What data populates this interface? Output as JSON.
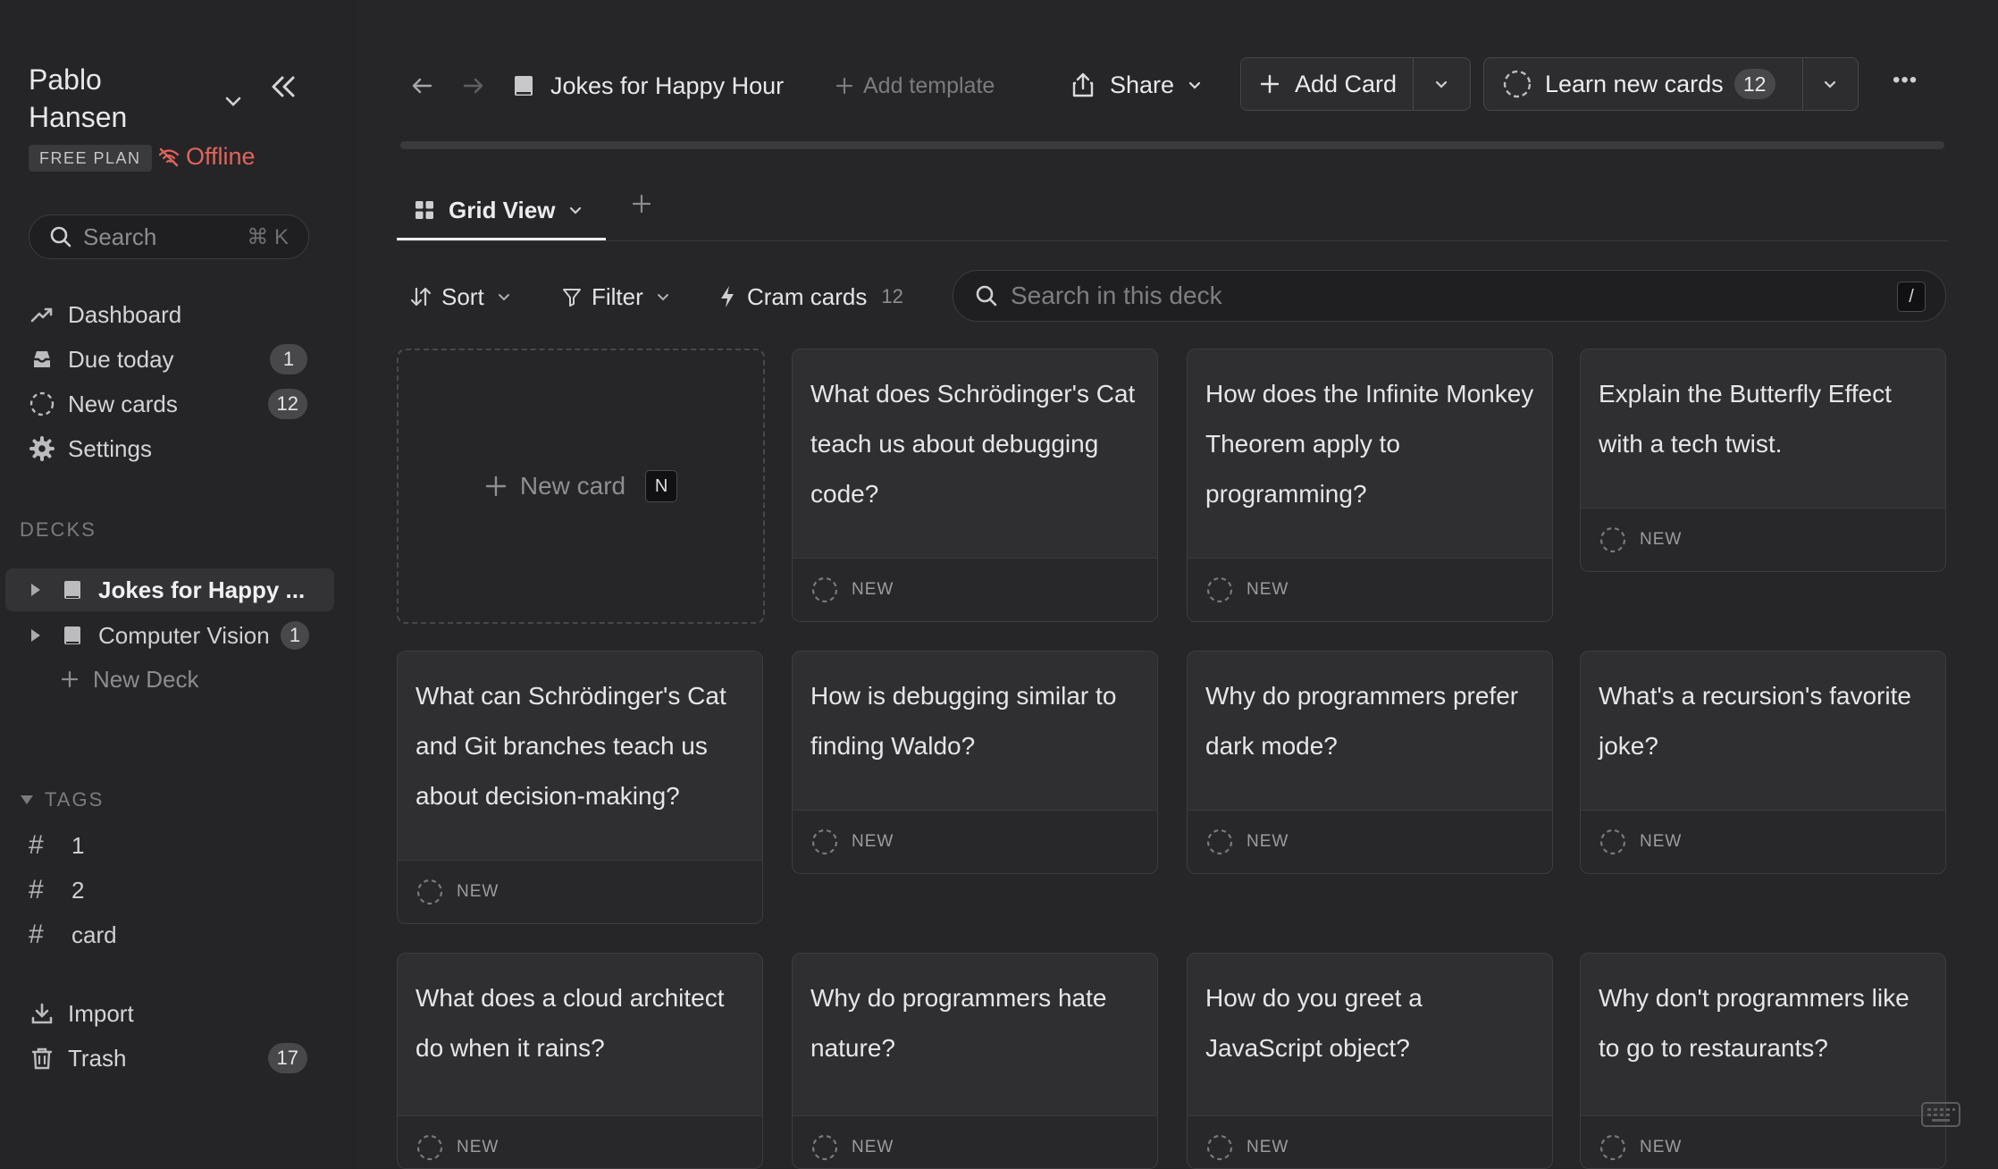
{
  "window": {
    "traffic_colors": [
      "#ee5f57",
      "#f5bd2e",
      "#29c840"
    ]
  },
  "sidebar": {
    "user_name": "Pablo Hansen",
    "plan": "FREE PLAN",
    "status": "Offline",
    "search": {
      "placeholder": "Search",
      "shortcut": "⌘ K"
    },
    "nav": [
      {
        "label": "Dashboard",
        "icon": "trend-icon"
      },
      {
        "label": "Due today",
        "icon": "inbox-icon",
        "count": "1"
      },
      {
        "label": "New cards",
        "icon": "dashed-circle-icon",
        "count": "12"
      },
      {
        "label": "Settings",
        "icon": "gear-icon"
      }
    ],
    "decks_label": "DECKS",
    "decks": [
      {
        "label": "Jokes for Happy ...",
        "active": true
      },
      {
        "label": "Computer Vision",
        "count": "1"
      }
    ],
    "new_deck": "New Deck",
    "tags_label": "TAGS",
    "tags": [
      "1",
      "2",
      "card"
    ],
    "import": "Import",
    "trash": {
      "label": "Trash",
      "count": "17"
    }
  },
  "toolbar": {
    "deck_title": "Jokes for Happy Hour",
    "add_template": "Add template",
    "share": "Share",
    "add_card": "Add Card",
    "learn": "Learn new cards",
    "learn_count": "12",
    "more": "•••"
  },
  "views": {
    "active": "Grid View"
  },
  "filters": {
    "sort": "Sort",
    "filter": "Filter",
    "cram": "Cram cards",
    "cram_count": "12",
    "search_placeholder": "Search in this deck",
    "search_shortcut": "/"
  },
  "grid": {
    "new_card_label": "New card",
    "new_card_shortcut": "N",
    "status_label": "NEW",
    "cards": [
      "What does Schrödinger's Cat teach us about debugging code?",
      "How does the Infinite Monkey Theorem apply to programming?",
      "Explain the Butterfly Effect with a tech twist.",
      "What can Schrödinger's Cat and Git branches teach us about decision-making?",
      "How is debugging similar to finding Waldo?",
      "Why do programmers prefer dark mode?",
      "What's a recursion's favorite joke?",
      "What does a cloud architect do when it rains?",
      "Why do programmers hate nature?",
      "How do you greet a JavaScript object?",
      "Why don't programmers like to go to restaurants?"
    ]
  }
}
